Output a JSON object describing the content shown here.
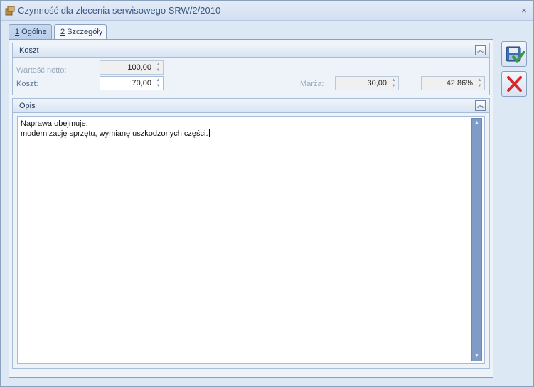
{
  "window": {
    "title": "Czynność dla zlecenia serwisowego SRW/2/2010",
    "minimize_glyph": "–",
    "close_glyph": "×"
  },
  "tabs": [
    {
      "hotkey": "1",
      "label": " Ogólne",
      "active": false
    },
    {
      "hotkey": "2",
      "label": " Szczegóły",
      "active": true
    }
  ],
  "koszt_group": {
    "title": "Koszt",
    "wartosc_netto_label": "Wartość netto:",
    "wartosc_netto_value": "100,00",
    "koszt_label": "Koszt:",
    "koszt_value": "70,00",
    "marza_label": "Marża:",
    "marza_value": "30,00",
    "marza_percent": "42,86%"
  },
  "opis_group": {
    "title": "Opis",
    "text_line1": "Naprawa obejmuje:",
    "text_line2": "modernizację sprzętu, wymianę uszkodzonych części."
  },
  "icons": {
    "save": "save-icon",
    "cancel": "cancel-icon",
    "collapse": "collapse-icon"
  },
  "colors": {
    "accent": "#3b5a82",
    "cancel_red": "#d9262a",
    "check_green": "#3a9b3a"
  }
}
